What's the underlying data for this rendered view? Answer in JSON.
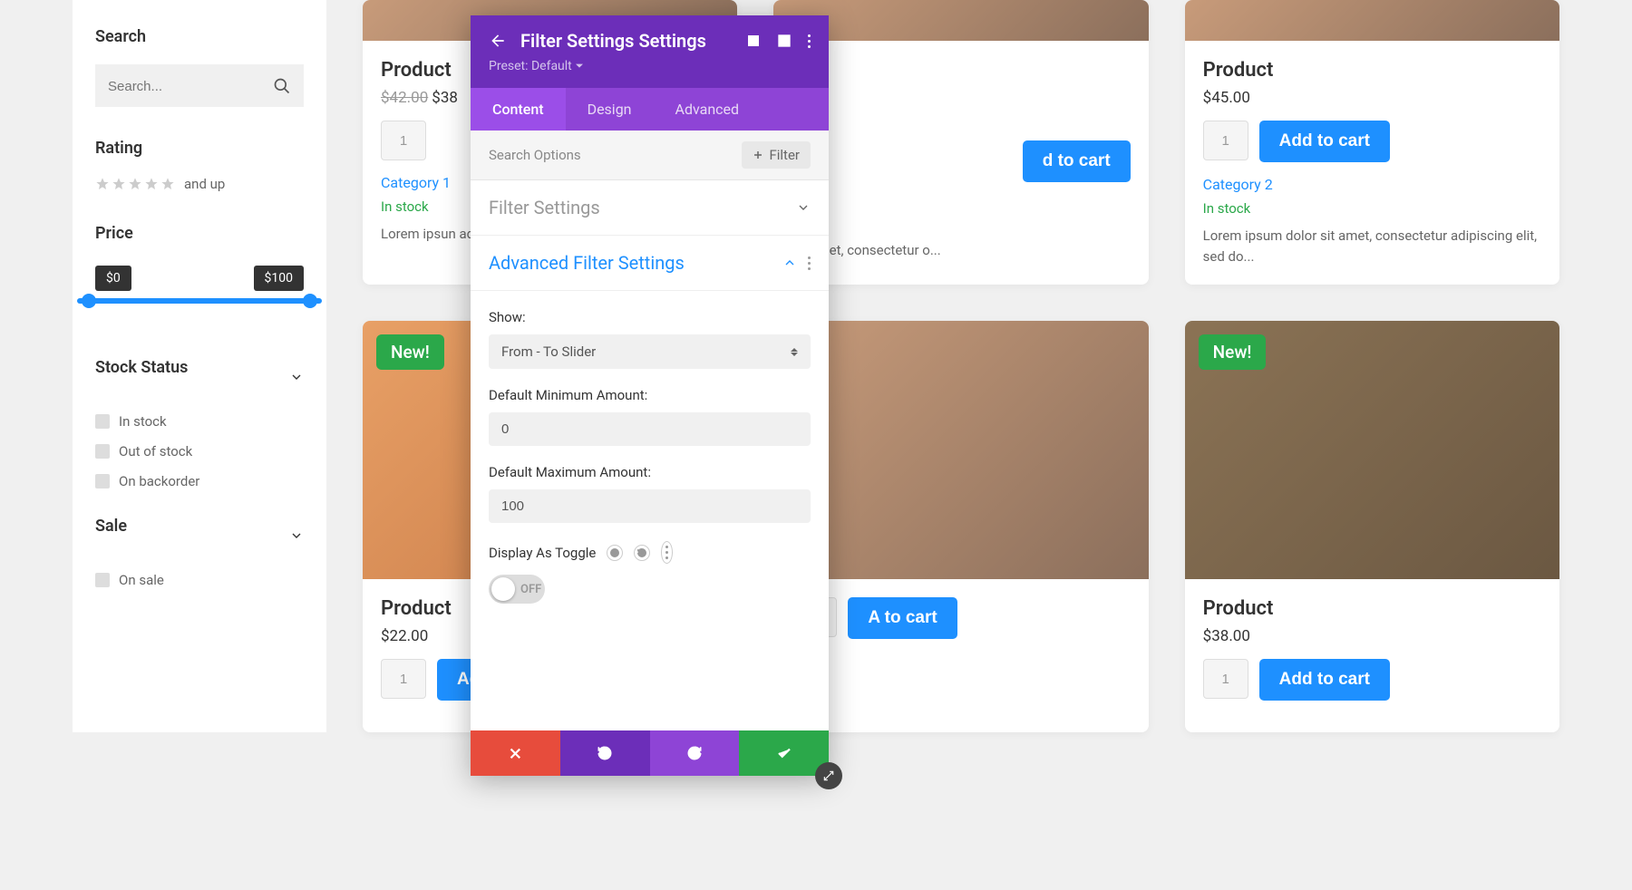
{
  "sidebar": {
    "search": {
      "heading": "Search",
      "placeholder": "Search..."
    },
    "rating": {
      "heading": "Rating",
      "and_up": "and up"
    },
    "price": {
      "heading": "Price",
      "min": "$0",
      "max": "$100"
    },
    "stock": {
      "heading": "Stock Status",
      "options": [
        "In stock",
        "Out of stock",
        "On backorder"
      ]
    },
    "sale": {
      "heading": "Sale",
      "on_sale": "On sale"
    }
  },
  "products": [
    {
      "title": "Product",
      "old_price": "$42.00",
      "price": "$38",
      "qty": "1",
      "add": "d to cart",
      "category": "Category 1",
      "stock": "In stock",
      "desc": "Lorem ipsun\nadipiscing "
    },
    {
      "title": "Product",
      "price": "$45.00",
      "qty": "1",
      "add": "Add to cart",
      "category": "Category 2",
      "stock": "In stock",
      "desc": "Lorem ipsum dolor sit amet, consectetur adipiscing elit, sed do..."
    },
    {
      "new": "New!",
      "title": "Product",
      "price": "$22.00",
      "qty": "1",
      "add": "Add to cart"
    },
    {
      "new": "New!",
      "title": "Product",
      "price": "$38.00",
      "qty": "1",
      "add": "Add to cart"
    }
  ],
  "modal": {
    "title": "Filter Settings Settings",
    "preset": "Preset: Default",
    "tabs": [
      "Content",
      "Design",
      "Advanced"
    ],
    "search_options": "Search Options",
    "filter_btn": "Filter",
    "filter_settings": "Filter Settings",
    "advanced_filter": "Advanced Filter Settings",
    "show_label": "Show:",
    "show_value": "From - To Slider",
    "def_min_label": "Default Minimum Amount:",
    "def_min_value": "0",
    "def_max_label": "Default Maximum Amount:",
    "def_max_value": "100",
    "display_toggle": "Display As Toggle",
    "toggle_state": "OFF"
  },
  "partial": {
    "add_cart_2": "A to cart",
    "desc_2": "sit amet, consectetur o..."
  }
}
